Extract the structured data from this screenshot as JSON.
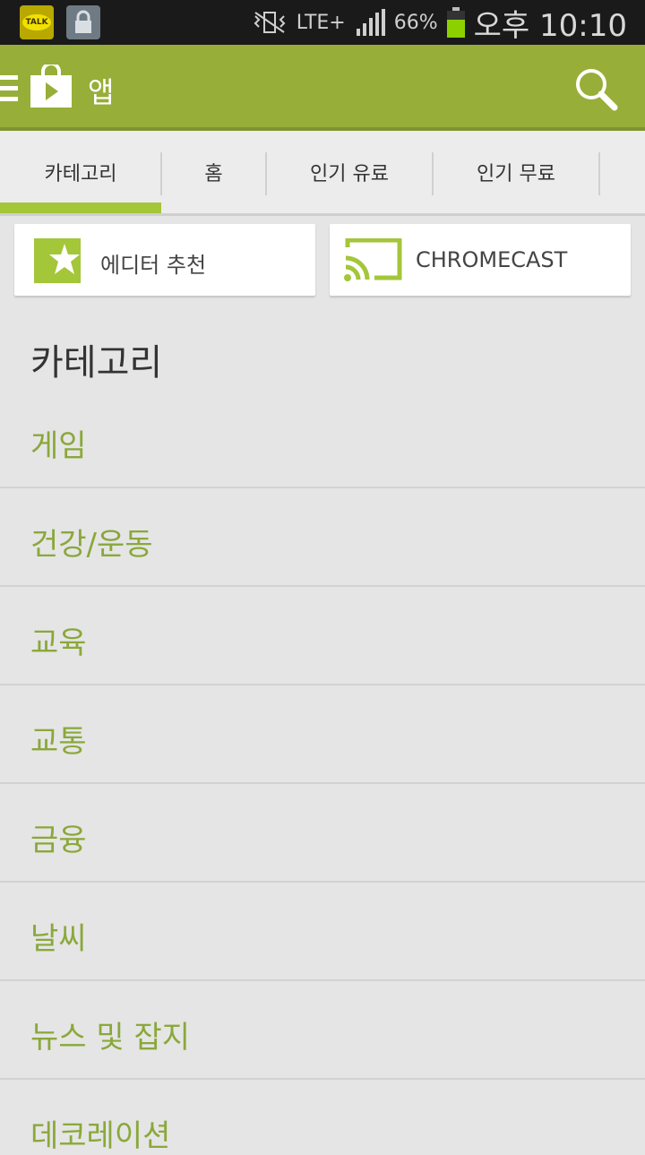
{
  "status_bar": {
    "notifications": [
      {
        "name": "kakaotalk-icon",
        "label": "TALK"
      },
      {
        "name": "lock-icon",
        "label": ""
      }
    ],
    "network": "LTE+",
    "battery_percent": "66%",
    "time": "오후 10:10"
  },
  "action_bar": {
    "title": "앱"
  },
  "tabs": [
    {
      "label": "카테고리",
      "selected": true
    },
    {
      "label": "홈",
      "selected": false
    },
    {
      "label": "인기 유료",
      "selected": false
    },
    {
      "label": "인기 무료",
      "selected": false
    }
  ],
  "cards": [
    {
      "label": "에디터 추천",
      "icon": "editors-choice-star-icon"
    },
    {
      "label": "CHROMECAST",
      "icon": "chromecast-icon"
    }
  ],
  "section_title": "카테고리",
  "categories": [
    "게임",
    "건강/운동",
    "교육",
    "교통",
    "금융",
    "날씨",
    "뉴스 및 잡지",
    "데코레이션"
  ],
  "colors": {
    "action_bar": "#97ae38",
    "accent": "#a4c639",
    "category_text": "#8aa83a",
    "background": "#e5e5e5"
  }
}
